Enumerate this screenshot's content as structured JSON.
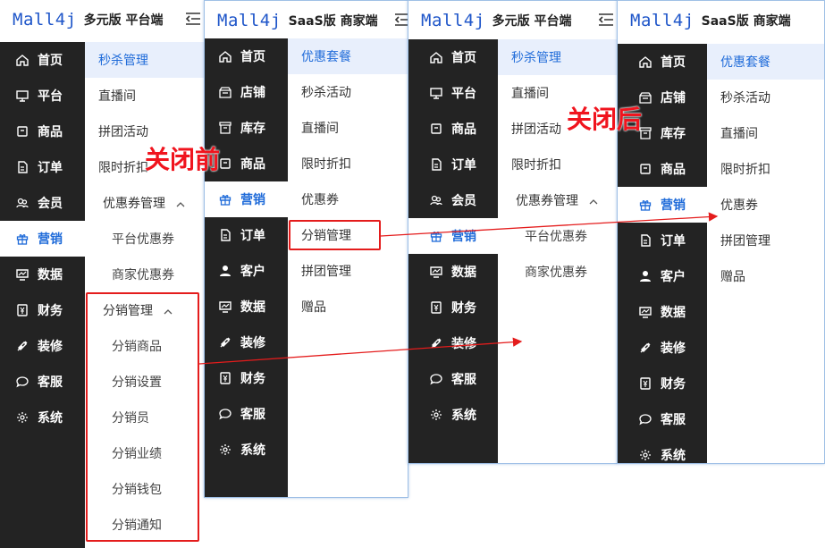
{
  "panels": {
    "p1": {
      "logo": "Mall4j",
      "edition": "多元版 平台端",
      "nav": [
        "首页",
        "平台",
        "商品",
        "订单",
        "会员",
        "营销",
        "数据",
        "财务",
        "装修",
        "客服",
        "系统"
      ],
      "nav_icons": [
        "home-icon",
        "monitor-icon",
        "box-icon",
        "order-icon",
        "member-icon",
        "gift-icon",
        "chart-icon",
        "finance-icon",
        "palette-icon",
        "chat-icon",
        "gear-icon"
      ],
      "active_nav": "营销",
      "sub": {
        "selected": "秒杀管理",
        "items": [
          "直播间",
          "拼团活动",
          "限时折扣"
        ],
        "group1": "优惠券管理",
        "group1_children": [
          "平台优惠券",
          "商家优惠券"
        ],
        "group2": "分销管理",
        "group2_children": [
          "分销商品",
          "分销设置",
          "分销员",
          "分销业绩",
          "分销钱包",
          "分销通知"
        ]
      }
    },
    "p2": {
      "logo": "Mall4j",
      "edition": "SaaS版 商家端",
      "nav": [
        "首页",
        "店铺",
        "库存",
        "商品",
        "营销",
        "订单",
        "客户",
        "数据",
        "装修",
        "财务",
        "客服",
        "系统"
      ],
      "nav_icons": [
        "home-icon",
        "shop-icon",
        "inventory-icon",
        "box-icon",
        "gift-icon",
        "order-icon",
        "user-icon",
        "chart-icon",
        "palette-icon",
        "finance-icon",
        "chat-icon",
        "gear-icon"
      ],
      "active_nav": "营销",
      "sub": {
        "selected": "优惠套餐",
        "items": [
          "秒杀活动",
          "直播间",
          "限时折扣",
          "优惠券",
          "分销管理",
          "拼团管理",
          "赠品"
        ]
      }
    },
    "p3": {
      "logo": "Mall4j",
      "edition": "多元版 平台端",
      "nav": [
        "首页",
        "平台",
        "商品",
        "订单",
        "会员",
        "营销",
        "数据",
        "财务",
        "装修",
        "客服",
        "系统"
      ],
      "nav_icons": [
        "home-icon",
        "monitor-icon",
        "box-icon",
        "order-icon",
        "member-icon",
        "gift-icon",
        "chart-icon",
        "finance-icon",
        "palette-icon",
        "chat-icon",
        "gear-icon"
      ],
      "active_nav": "营销",
      "sub": {
        "selected": "秒杀管理",
        "items": [
          "直播间",
          "拼团活动",
          "限时折扣"
        ],
        "group1": "优惠券管理",
        "group1_children": [
          "平台优惠券",
          "商家优惠券"
        ]
      }
    },
    "p4": {
      "logo": "Mall4j",
      "edition": "SaaS版 商家端",
      "nav": [
        "首页",
        "店铺",
        "库存",
        "商品",
        "营销",
        "订单",
        "客户",
        "数据",
        "装修",
        "财务",
        "客服",
        "系统"
      ],
      "nav_icons": [
        "home-icon",
        "shop-icon",
        "inventory-icon",
        "box-icon",
        "gift-icon",
        "order-icon",
        "user-icon",
        "chart-icon",
        "palette-icon",
        "finance-icon",
        "chat-icon",
        "gear-icon"
      ],
      "active_nav": "营销",
      "sub": {
        "selected": "优惠套餐",
        "items": [
          "秒杀活动",
          "直播间",
          "限时折扣",
          "优惠券",
          "拼团管理",
          "赠品"
        ]
      }
    }
  },
  "annotations": {
    "before": "关闭前",
    "after": "关闭后"
  },
  "colors": {
    "sidebar": "#232323",
    "accent": "#1f6bd9",
    "highlight": "#e8effc",
    "annotation_red": "#e41c1c"
  }
}
